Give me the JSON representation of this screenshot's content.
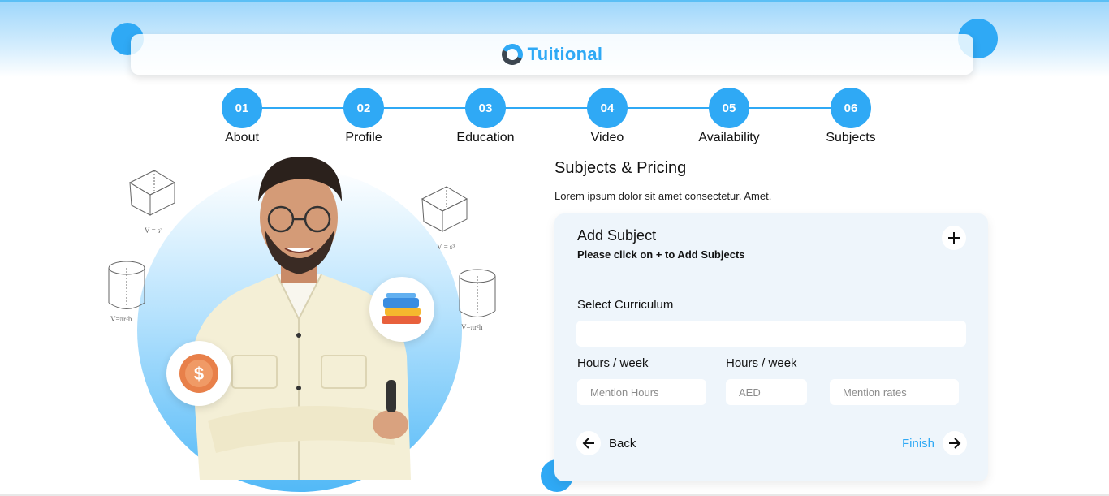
{
  "brand": {
    "name": "Tuitional",
    "accent": "#2fa9f5"
  },
  "steps": [
    {
      "number": "01",
      "label": "About"
    },
    {
      "number": "02",
      "label": "Profile"
    },
    {
      "number": "03",
      "label": "Education"
    },
    {
      "number": "04",
      "label": "Video"
    },
    {
      "number": "05",
      "label": "Availability"
    },
    {
      "number": "06",
      "label": "Subjects"
    }
  ],
  "form": {
    "title": "Subjects & Pricing",
    "subtitle": "Lorem ipsum dolor sit amet consectetur. Amet.",
    "card": {
      "title": "Add Subject",
      "note": "Please click on + to Add Subjects",
      "plus_icon": "+",
      "curriculum_label": "Select Curriculum",
      "curriculum_value": "",
      "hours_label_1": "Hours / week",
      "hours_label_2": "Hours / week",
      "hours_placeholder": "Mention Hours",
      "currency_placeholder": "AED",
      "rates_placeholder": "Mention rates",
      "back_label": "Back",
      "finish_label": "Finish"
    }
  },
  "icons": {
    "plus": "plus-icon",
    "back": "arrow-left-icon",
    "finish": "arrow-right-icon",
    "books": "books-icon",
    "coin": "dollar-coin-icon"
  },
  "doodles": {
    "cube_formula": "V = s³",
    "cylinder_formula": "V=πr²h"
  }
}
